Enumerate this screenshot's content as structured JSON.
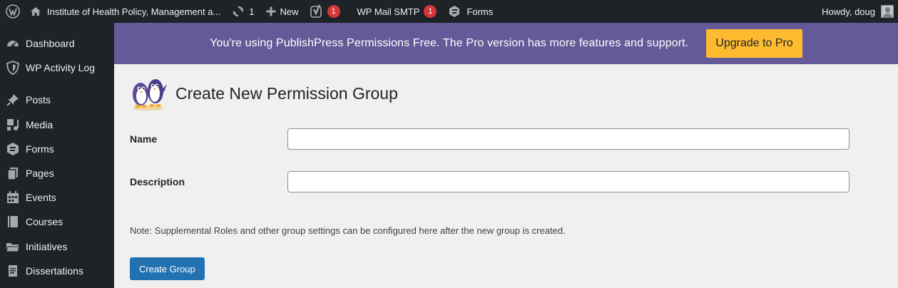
{
  "adminbar": {
    "site_name": "Institute of Health Policy, Management a...",
    "updates_count": "1",
    "new_label": "New",
    "yoast_count": "1",
    "smtp_label": "WP Mail SMTP",
    "smtp_count": "1",
    "forms_label": "Forms",
    "greeting": "Howdy, doug"
  },
  "sidebar": {
    "items": [
      {
        "label": "Dashboard",
        "icon": "dashboard-icon"
      },
      {
        "label": "WP Activity Log",
        "icon": "shield-icon"
      },
      {
        "label": "Posts",
        "icon": "pin-icon"
      },
      {
        "label": "Media",
        "icon": "media-icon"
      },
      {
        "label": "Forms",
        "icon": "forms-icon"
      },
      {
        "label": "Pages",
        "icon": "pages-icon"
      },
      {
        "label": "Events",
        "icon": "calendar-icon"
      },
      {
        "label": "Courses",
        "icon": "book-icon"
      },
      {
        "label": "Initiatives",
        "icon": "folder-icon"
      },
      {
        "label": "Dissertations",
        "icon": "document-icon"
      }
    ]
  },
  "banner": {
    "text": "You're using PublishPress Permissions Free. The Pro version has more features and support.",
    "button_label": "Upgrade to Pro"
  },
  "page": {
    "title": "Create New Permission Group",
    "name_label": "Name",
    "name_value": "",
    "description_label": "Description",
    "description_value": "",
    "note": "Note: Supplemental Roles and other group settings can be configured here after the new group is created.",
    "submit_label": "Create Group"
  },
  "colors": {
    "adminbar_bg": "#1d2327",
    "banner_bg": "#655997",
    "upgrade_button": "#febb30",
    "primary_button": "#2271b1",
    "badge": "#d63638"
  }
}
